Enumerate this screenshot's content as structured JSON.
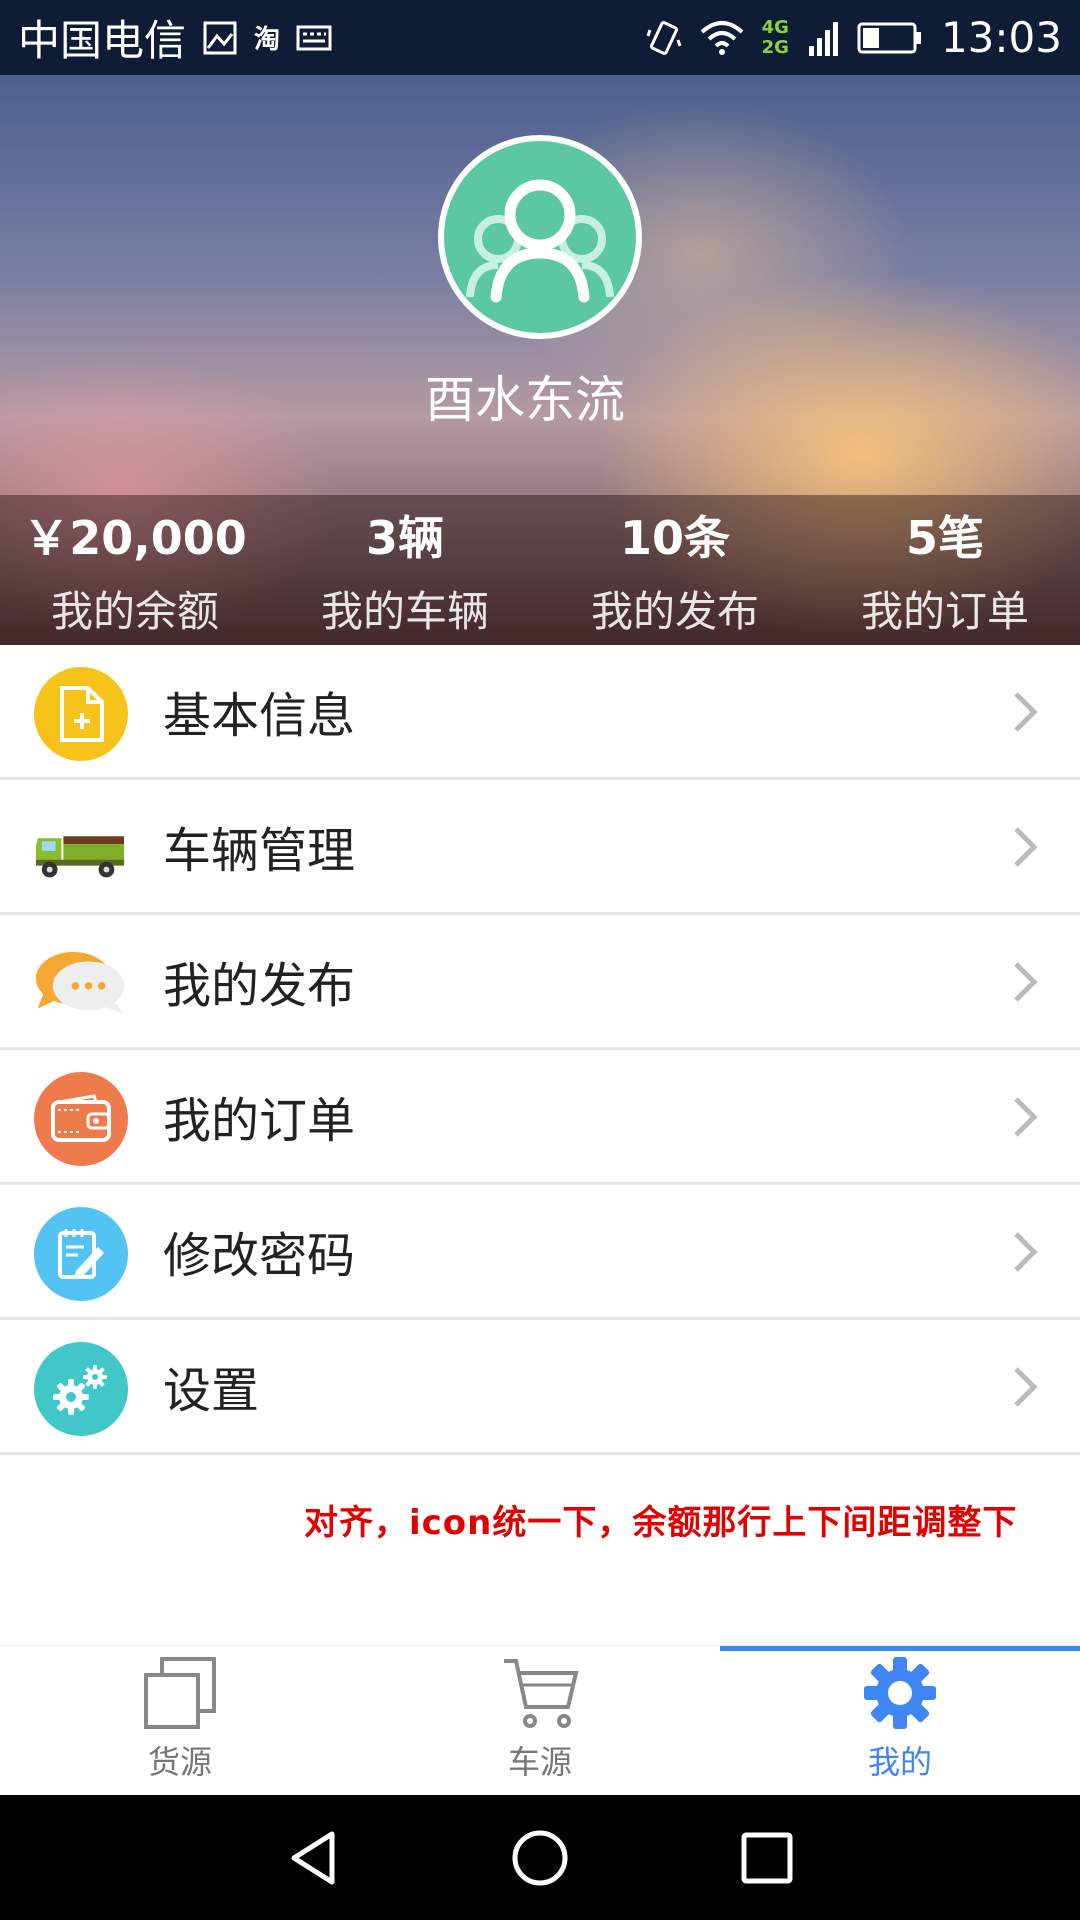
{
  "status_bar": {
    "carrier": "中国电信",
    "carrier_app_icon": "淘",
    "network_4g": "4G",
    "network_2g": "2G",
    "time": "13:03"
  },
  "profile": {
    "username": "酉水东流",
    "avatar_color": "#5bc8a3"
  },
  "stats": [
    {
      "value": "￥20,000",
      "label": "我的余额"
    },
    {
      "value": "3辆",
      "label": "我的车辆"
    },
    {
      "value": "10条",
      "label": "我的发布"
    },
    {
      "value": "5笔",
      "label": "我的订单"
    }
  ],
  "menu": [
    {
      "label": "基本信息",
      "icon": "document-add-icon",
      "color": "#f7c21a"
    },
    {
      "label": "车辆管理",
      "icon": "truck-icon",
      "color": "#7fae2b"
    },
    {
      "label": "我的发布",
      "icon": "chat-bubble-icon",
      "color": "#f4a833"
    },
    {
      "label": "我的订单",
      "icon": "wallet-icon",
      "color": "#ef7b4c"
    },
    {
      "label": "修改密码",
      "icon": "edit-note-icon",
      "color": "#52c3f2"
    },
    {
      "label": "设置",
      "icon": "gears-icon",
      "color": "#41c7c9"
    }
  ],
  "note": "对齐，icon统一下，余额那行上下间距调整下",
  "tabbar": {
    "tabs": [
      {
        "label": "货源",
        "icon": "stacked-squares-icon"
      },
      {
        "label": "车源",
        "icon": "cart-icon"
      },
      {
        "label": "我的",
        "icon": "gear-icon"
      }
    ],
    "active": "我的",
    "accent": "#3f86f4"
  },
  "nav": [
    "back-icon",
    "home-icon",
    "recents-icon"
  ]
}
